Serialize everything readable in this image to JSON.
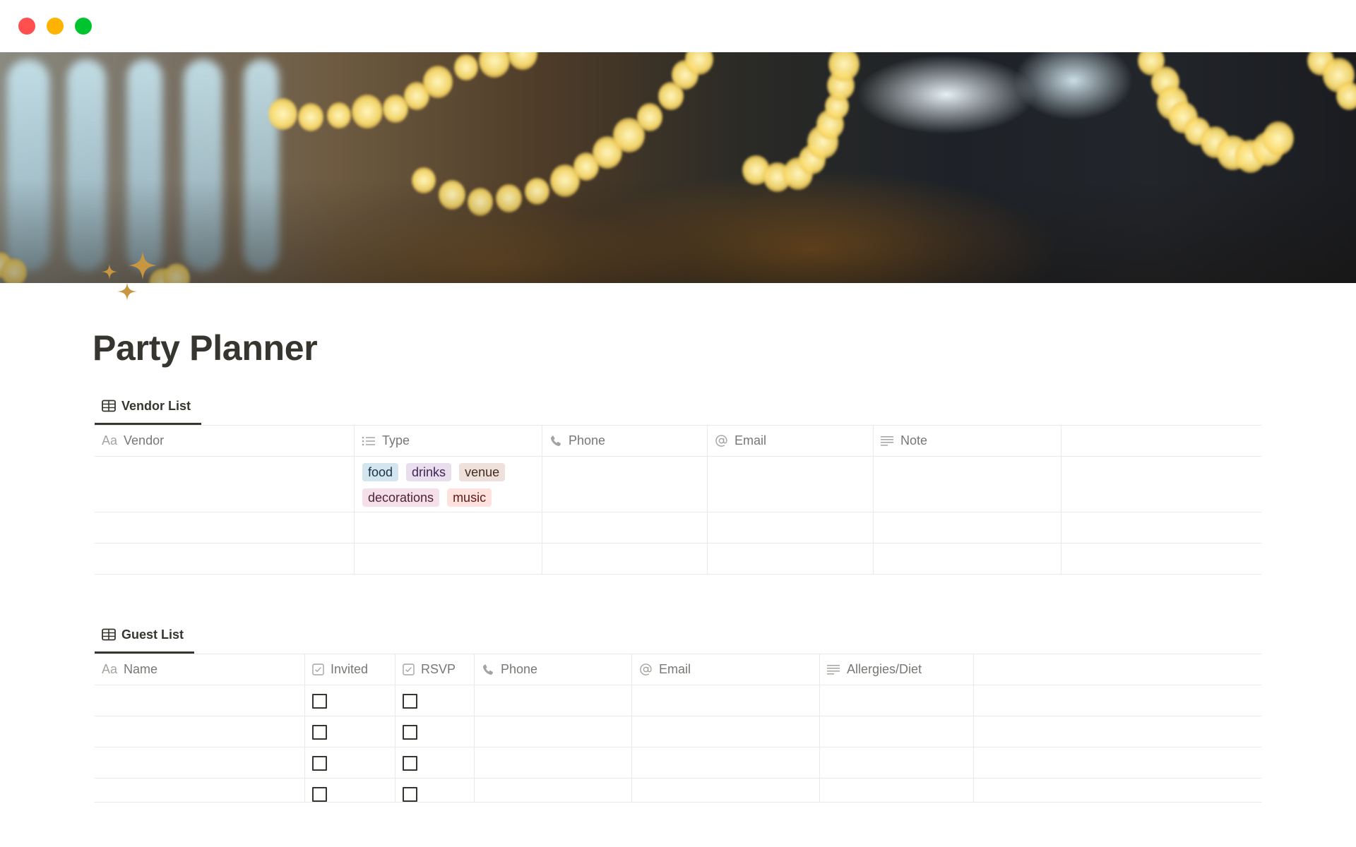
{
  "window": {
    "controls": [
      {
        "name": "close",
        "color": "#FF4F4F"
      },
      {
        "name": "minimize",
        "color": "#FFB300"
      },
      {
        "name": "maximize",
        "color": "#00C42D"
      }
    ]
  },
  "page": {
    "icon": "sparkles-icon",
    "icon_color": "#C8963E",
    "cover": "string-lights-bokeh-photo",
    "title": "Party Planner"
  },
  "vendor_list": {
    "tab_label": "Vendor List",
    "tab_icon": "table-icon",
    "columns": [
      {
        "label": "Vendor",
        "icon": "title-aa-icon"
      },
      {
        "label": "Type",
        "icon": "multi-select-icon"
      },
      {
        "label": "Phone",
        "icon": "phone-icon"
      },
      {
        "label": "Email",
        "icon": "at-sign-icon"
      },
      {
        "label": "Note",
        "icon": "text-lines-icon"
      },
      {
        "label": "",
        "icon": ""
      }
    ],
    "rows": [
      {
        "vendor": "",
        "type": [
          "food",
          "drinks",
          "venue",
          "decorations",
          "music"
        ],
        "phone": "",
        "email": "",
        "note": ""
      },
      {
        "vendor": "",
        "type": [],
        "phone": "",
        "email": "",
        "note": ""
      },
      {
        "vendor": "",
        "type": [],
        "phone": "",
        "email": "",
        "note": ""
      }
    ],
    "tag_colors": {
      "food": {
        "bg": "#D3E5EF",
        "fg": "#183347"
      },
      "drinks": {
        "bg": "#E8DEEE",
        "fg": "#412454"
      },
      "venue": {
        "bg": "#EEE0DA",
        "fg": "#442A1E"
      },
      "decorations": {
        "bg": "#F5E0E9",
        "fg": "#4C2337"
      },
      "music": {
        "bg": "#FFE2DD",
        "fg": "#5D1715"
      }
    }
  },
  "guest_list": {
    "tab_label": "Guest List",
    "tab_icon": "table-icon",
    "columns": [
      {
        "label": "Name",
        "icon": "title-aa-icon"
      },
      {
        "label": "Invited",
        "icon": "checkbox-icon"
      },
      {
        "label": "RSVP",
        "icon": "checkbox-icon"
      },
      {
        "label": "Phone",
        "icon": "phone-icon"
      },
      {
        "label": "Email",
        "icon": "at-sign-icon"
      },
      {
        "label": "Allergies/Diet",
        "icon": "text-lines-icon"
      },
      {
        "label": "",
        "icon": ""
      }
    ],
    "rows": [
      {
        "name": "",
        "invited": false,
        "rsvp": false,
        "phone": "",
        "email": "",
        "allergies": ""
      },
      {
        "name": "",
        "invited": false,
        "rsvp": false,
        "phone": "",
        "email": "",
        "allergies": ""
      },
      {
        "name": "",
        "invited": false,
        "rsvp": false,
        "phone": "",
        "email": "",
        "allergies": ""
      },
      {
        "name": "",
        "invited": false,
        "rsvp": false,
        "phone": "",
        "email": "",
        "allergies": ""
      }
    ]
  }
}
